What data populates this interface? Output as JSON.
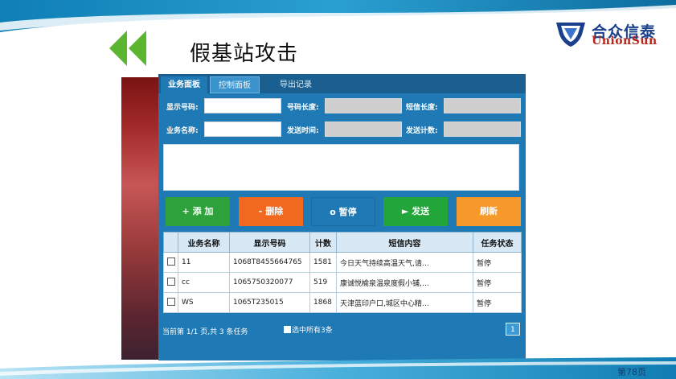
{
  "slide": {
    "title": "假基站攻击",
    "page_number": "第78页"
  },
  "logo": {
    "cn": "合众信泰",
    "en": "UnionSun"
  },
  "tabs": [
    {
      "label": "业务面板"
    },
    {
      "label": "控制面板"
    },
    {
      "label": "导出记录"
    }
  ],
  "form": {
    "display_number_label": "显示号码:",
    "display_number_value": "",
    "number_length_label": "号码长度:",
    "number_length_value": "",
    "sms_length_label": "短信长度:",
    "sms_length_value": "",
    "business_name_label": "业务名称:",
    "business_name_value": "",
    "send_time_label": "发送时间:",
    "send_time_value": "",
    "send_count_label": "发送计数:",
    "send_count_value": "",
    "message_value": ""
  },
  "buttons": {
    "add": "+ 添 加",
    "delete": "- 删除",
    "pause": "o 暂停",
    "send": "► 发送",
    "refresh": "刷新"
  },
  "table": {
    "headers": [
      "",
      "业务名称",
      "显示号码",
      "计数",
      "短信内容",
      "任务状态"
    ],
    "rows": [
      {
        "name": "11",
        "number": "1068T8455664765",
        "count": "1581",
        "content": "今日天气持续高温天气,请…",
        "status": "暂停"
      },
      {
        "name": "cc",
        "number": "106575032007​7",
        "count": "519",
        "content": "康诚悦榆泉温泉度假小铺,…",
        "status": "暂停"
      },
      {
        "name": "WS",
        "number": "1065T235015",
        "count": "1868",
        "content": "天津蓝印户口,城区中心精…",
        "status": "暂停"
      }
    ]
  },
  "footer": {
    "summary": "当前第 1/1 页,共 3 条任务",
    "select_all": "选中所有3条",
    "page": "1"
  },
  "colors": {
    "app_background": "#1f79b4",
    "add": "#2ea23a",
    "delete": "#f0691f",
    "send": "#22a63a",
    "refresh": "#f59a2a",
    "arrows": "#5cb531"
  }
}
